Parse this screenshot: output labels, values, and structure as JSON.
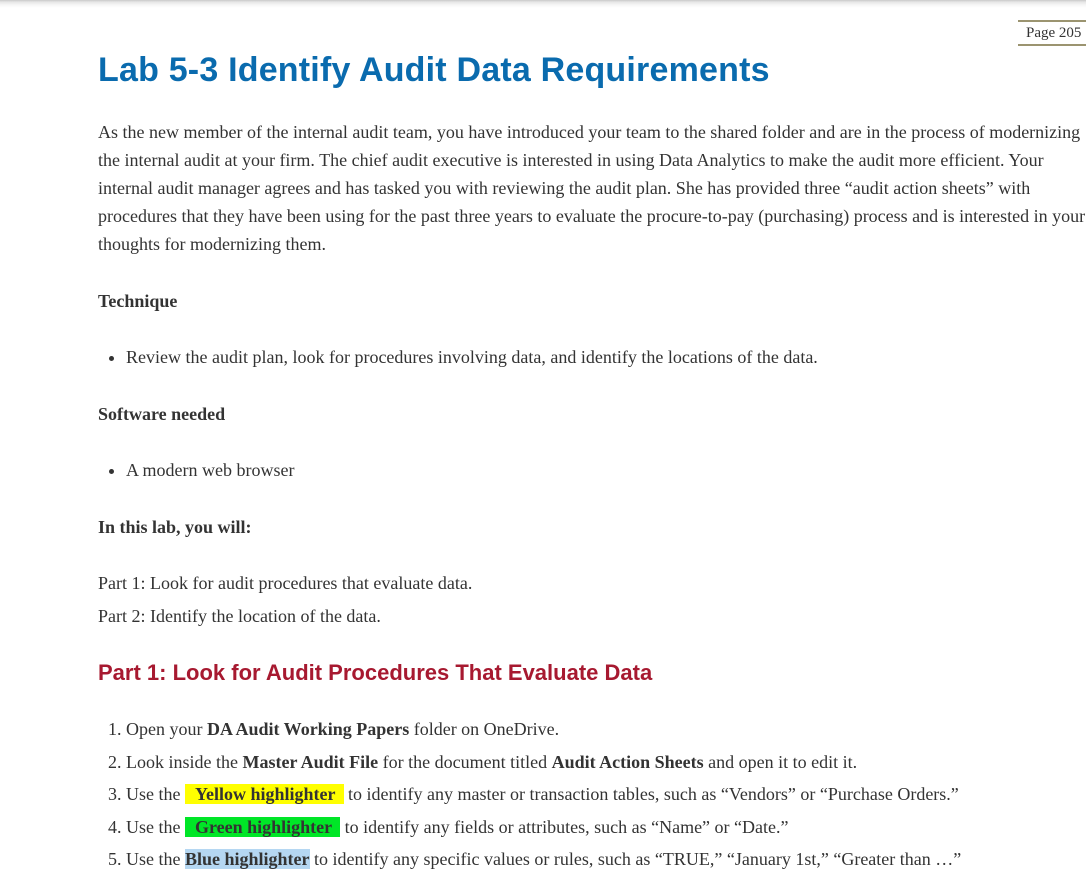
{
  "page_marker": "Page 205",
  "title": "Lab 5-3 Identify Audit Data Requirements",
  "intro": "As the new member of the internal audit team, you have introduced your team to the shared folder and are in the process of modernizing the internal audit at your firm. The chief audit executive is interested in using Data Analytics to make the audit more efficient. Your internal audit manager agrees and has tasked you with reviewing the audit plan. She has provided three “audit action sheets” with procedures that they have been using for the past three years to evaluate the procure-to-pay (purchasing) process and is interested in your thoughts for modernizing them.",
  "technique": {
    "heading": "Technique",
    "items": [
      "Review the audit plan, look for procedures involving data, and identify the locations of the data."
    ]
  },
  "software": {
    "heading": "Software needed",
    "items": [
      "A modern web browser"
    ]
  },
  "objectives": {
    "heading": "In this lab, you will:",
    "parts": [
      "Part 1: Look for audit procedures that evaluate data.",
      "Part 2: Identify the location of the data."
    ]
  },
  "part1": {
    "heading": "Part 1: Look for Audit Procedures That Evaluate Data",
    "steps": [
      {
        "pre": "Open your ",
        "bold": "DA Audit Working Papers",
        "post": " folder on OneDrive."
      },
      {
        "pre": "Look inside the ",
        "bold": "Master Audit File",
        "mid": " for the document titled ",
        "bold2": "Audit Action Sheets",
        "post": " and open it to edit it."
      },
      {
        "pre": "Use the ",
        "highlight": "Yellow highlighter",
        "post": " to identify any master or transaction tables, such as “Vendors” or “Purchase Orders.”"
      },
      {
        "pre": "Use the ",
        "highlight": "Green highlighter",
        "post": " to identify any fields or attributes, such as “Name” or “Date.”"
      },
      {
        "pre": "Use the ",
        "highlight": "Blue highlighter",
        "post": " to identify any specific values or rules, such as “TRUE,” “January 1st,” “Greater than …”"
      }
    ]
  },
  "colors": {
    "title": "#0a6bae",
    "part_heading": "#a71930",
    "highlight_yellow": "#ffff00",
    "highlight_green": "#00e627",
    "highlight_blue": "#b5d7f2"
  }
}
